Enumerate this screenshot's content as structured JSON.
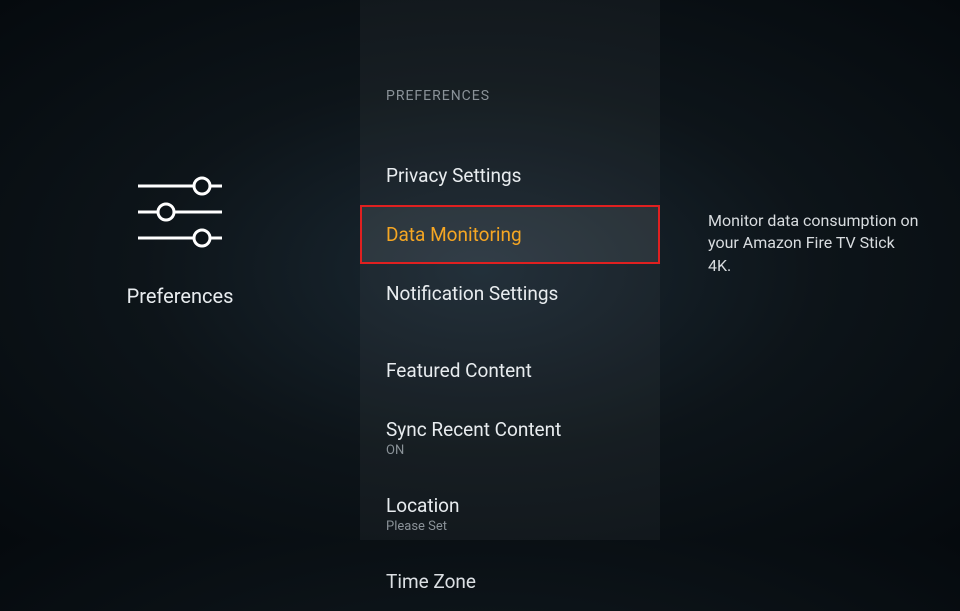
{
  "left": {
    "label": "Preferences"
  },
  "header": "Preferences",
  "items": [
    {
      "label": "Privacy Settings",
      "subtext": ""
    },
    {
      "label": "Data Monitoring",
      "subtext": "",
      "selected": true
    },
    {
      "label": "Notification Settings",
      "subtext": ""
    },
    {
      "label": "Featured Content",
      "subtext": ""
    },
    {
      "label": "Sync Recent Content",
      "subtext": "ON"
    },
    {
      "label": "Location",
      "subtext": "Please Set"
    },
    {
      "label": "Time Zone",
      "subtext": ""
    }
  ],
  "detail": {
    "description": "Monitor data consumption on your Amazon Fire TV Stick 4K."
  },
  "colors": {
    "accent": "#f5a623",
    "highlight_border": "#e02020"
  }
}
